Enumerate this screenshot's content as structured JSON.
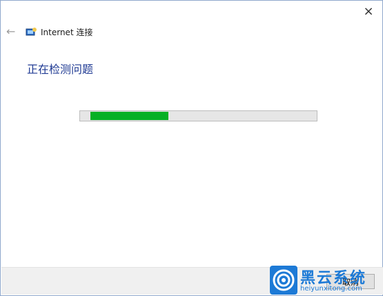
{
  "window": {
    "close_glyph": "×",
    "back_glyph": "←",
    "title": "Internet 连接"
  },
  "main": {
    "heading": "正在检测问题",
    "progress_fraction": 0.36
  },
  "footer": {
    "cancel_label": "取消"
  },
  "watermark": {
    "brand": "黑云系统",
    "url": "heiyunxitong.com"
  },
  "colors": {
    "accent": "#1f3a93",
    "progress": "#06b025",
    "watermark": "#1d7ad6"
  }
}
